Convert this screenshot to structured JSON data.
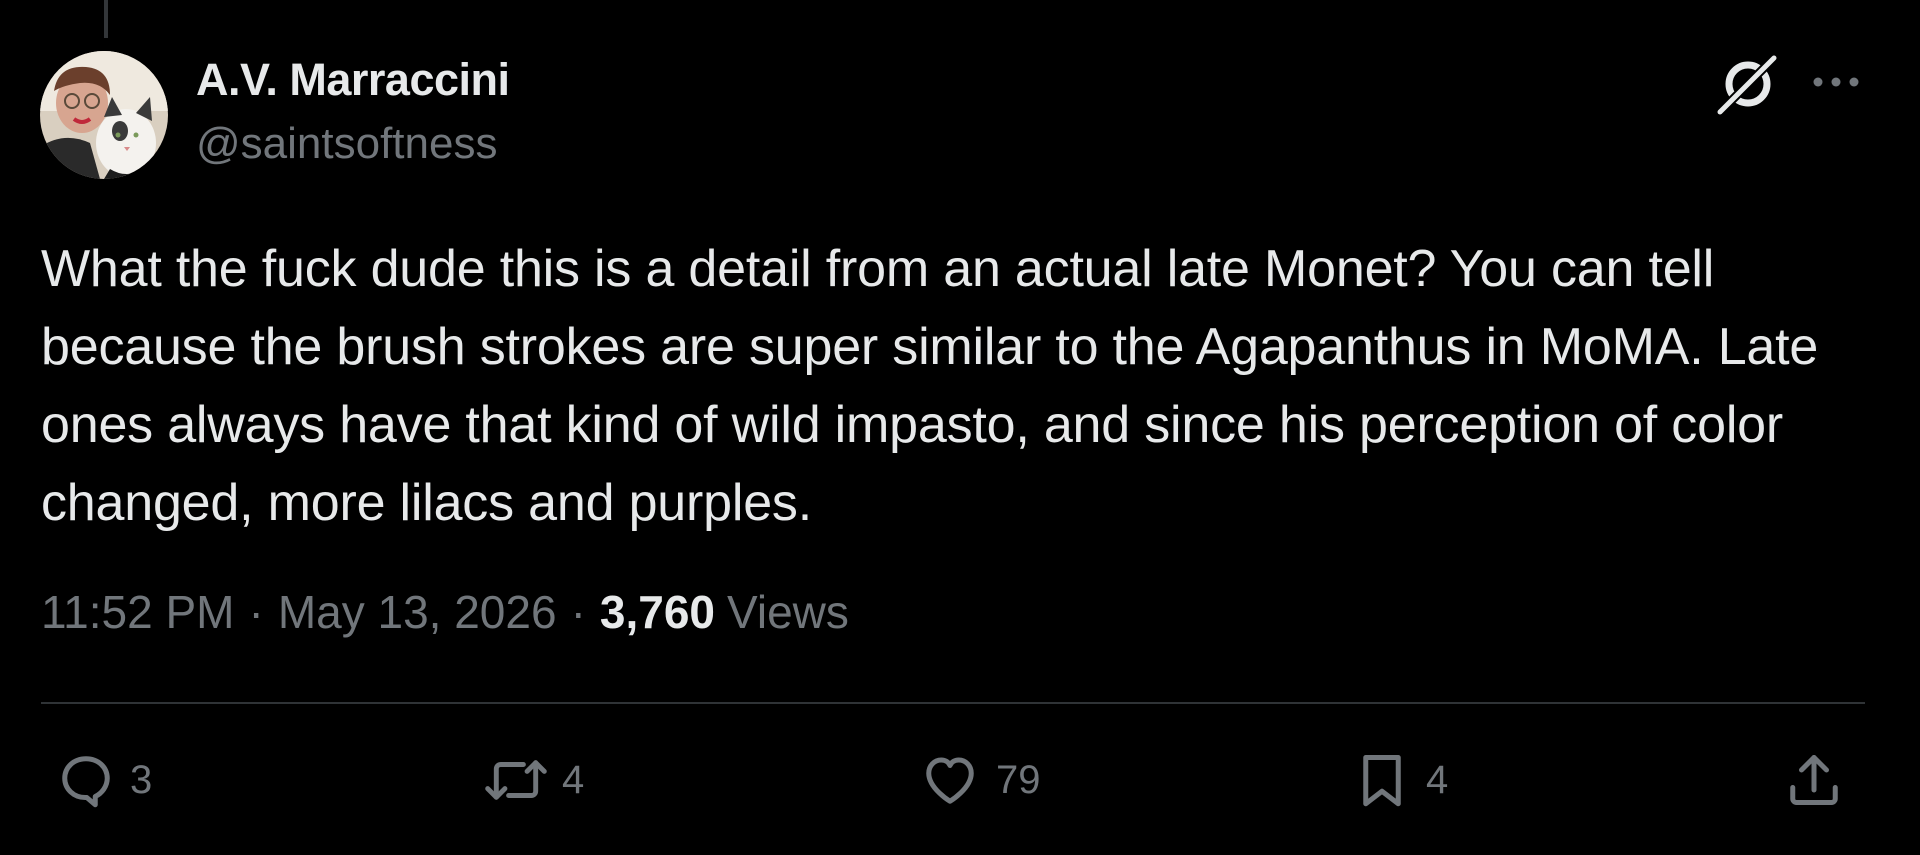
{
  "author": {
    "display_name": "A.V. Marraccini",
    "handle": "@saintsoftness",
    "avatar_icon": "avatar-photo"
  },
  "header_actions": {
    "grok_icon": "grok-icon",
    "more_icon": "more-icon"
  },
  "tweet": {
    "text": "What the fuck dude this is a detail from an actual late Monet? You can tell because the brush strokes are super similar to the Agapanthus in MoMA. Late ones always have that kind of wild impasto, and since his perception of color changed, more lilacs and purples.",
    "time": "11:52 PM",
    "separator": "·",
    "date": "May 13, 2026",
    "views_count": "3,760",
    "views_label": "Views"
  },
  "actions": {
    "reply_count": "3",
    "repost_count": "4",
    "like_count": "79",
    "bookmark_count": "4"
  },
  "colors": {
    "background": "#000000",
    "primary_text": "#e7e9ea",
    "secondary_text": "#71767b",
    "divider": "#2f3336"
  }
}
